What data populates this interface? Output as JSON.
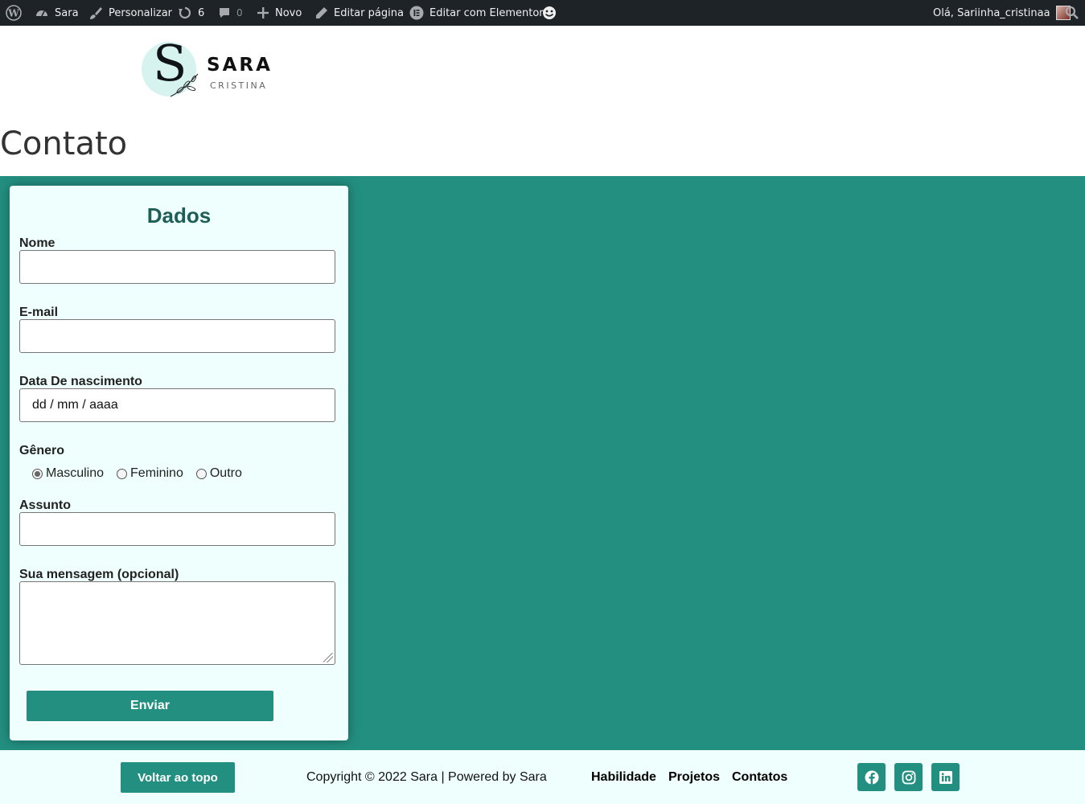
{
  "admin_bar": {
    "site_name": "Sara",
    "customize": "Personalizar",
    "updates_count": "6",
    "comments_count": "0",
    "new_label": "Novo",
    "edit_page": "Editar página",
    "edit_elementor": "Editar com Elementor",
    "greeting": "Olá, Sariinha_cristinaa"
  },
  "header": {
    "logo_letter": "S",
    "logo_name": "SARA",
    "logo_sub": "CRISTINA"
  },
  "page": {
    "title": "Contato"
  },
  "form": {
    "title": "Dados",
    "name_label": "Nome",
    "email_label": "E-mail",
    "dob_label": "Data De nascimento",
    "dob_placeholder": "dd / mm / aaaa",
    "gender_label": "Gênero",
    "gender_options": [
      "Masculino",
      "Feminino",
      "Outro"
    ],
    "gender_selected": "Masculino",
    "subject_label": "Assunto",
    "message_label": "Sua mensagem (opcional)",
    "submit_label": "Enviar"
  },
  "footer": {
    "back_to_top": "Voltar ao topo",
    "copyright": "Copyright © 2022 Sara | Powered by Sara",
    "links": [
      "Habilidade",
      "Projetos",
      "Contatos"
    ],
    "social_icons": [
      "facebook-icon",
      "instagram-icon",
      "linkedin-icon"
    ]
  },
  "colors": {
    "teal": "#238f80",
    "mint_background": "#eefffd",
    "admin_bar": "#1d2327"
  }
}
